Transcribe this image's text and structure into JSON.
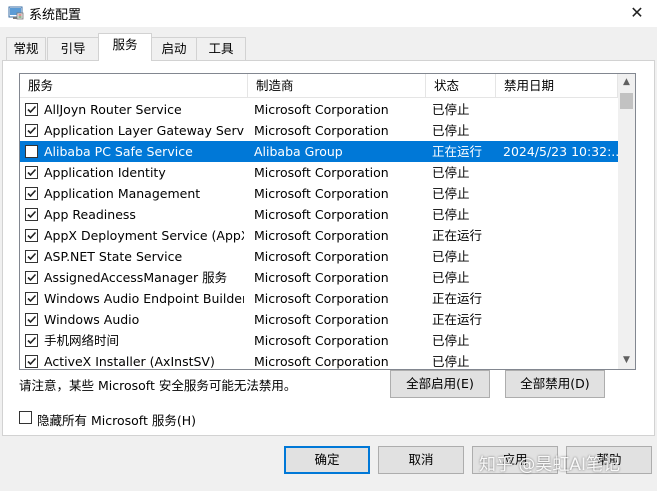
{
  "window": {
    "title": "系统配置",
    "close_glyph": "✕"
  },
  "tabs": [
    {
      "label": "常规",
      "active": false
    },
    {
      "label": "引导",
      "active": false
    },
    {
      "label": "服务",
      "active": true
    },
    {
      "label": "启动",
      "active": false
    },
    {
      "label": "工具",
      "active": false
    }
  ],
  "services": {
    "columns": [
      "服务",
      "制造商",
      "状态",
      "禁用日期"
    ],
    "rows": [
      {
        "checked": true,
        "name": "AllJoyn Router Service",
        "maker": "Microsoft Corporation",
        "status": "已停止",
        "date": ""
      },
      {
        "checked": true,
        "name": "Application Layer Gateway Service",
        "maker": "Microsoft Corporation",
        "status": "已停止",
        "date": ""
      },
      {
        "checked": false,
        "name": "Alibaba PC Safe Service",
        "maker": "Alibaba Group",
        "status": "正在运行",
        "date": "2024/5/23 10:32:...",
        "selected": true
      },
      {
        "checked": true,
        "name": "Application Identity",
        "maker": "Microsoft Corporation",
        "status": "已停止",
        "date": ""
      },
      {
        "checked": true,
        "name": "Application Management",
        "maker": "Microsoft Corporation",
        "status": "已停止",
        "date": ""
      },
      {
        "checked": true,
        "name": "App Readiness",
        "maker": "Microsoft Corporation",
        "status": "已停止",
        "date": ""
      },
      {
        "checked": true,
        "name": "AppX Deployment Service (AppX...",
        "maker": "Microsoft Corporation",
        "status": "正在运行",
        "date": ""
      },
      {
        "checked": true,
        "name": "ASP.NET State Service",
        "maker": "Microsoft Corporation",
        "status": "已停止",
        "date": ""
      },
      {
        "checked": true,
        "name": "AssignedAccessManager 服务",
        "maker": "Microsoft Corporation",
        "status": "已停止",
        "date": ""
      },
      {
        "checked": true,
        "name": "Windows Audio Endpoint Builder",
        "maker": "Microsoft Corporation",
        "status": "正在运行",
        "date": ""
      },
      {
        "checked": true,
        "name": "Windows Audio",
        "maker": "Microsoft Corporation",
        "status": "正在运行",
        "date": ""
      },
      {
        "checked": true,
        "name": "手机网络时间",
        "maker": "Microsoft Corporation",
        "status": "已停止",
        "date": ""
      },
      {
        "checked": true,
        "name": "ActiveX Installer (AxInstSV)",
        "maker": "Microsoft Corporation",
        "status": "已停止",
        "date": ""
      }
    ]
  },
  "notice": "请注意，某些 Microsoft 安全服务可能无法禁用。",
  "buttons": {
    "enable_all": "全部启用(E)",
    "disable_all": "全部禁用(D)",
    "ok": "确定",
    "cancel": "取消",
    "apply": "应用",
    "help": "帮助"
  },
  "hide_ms": {
    "label": "隐藏所有 Microsoft 服务(H)",
    "checked": false
  },
  "watermark": "知乎 @昊虹AI笔记",
  "colors": {
    "selection": "#0078d7",
    "default_button_border": "#0078d7"
  }
}
